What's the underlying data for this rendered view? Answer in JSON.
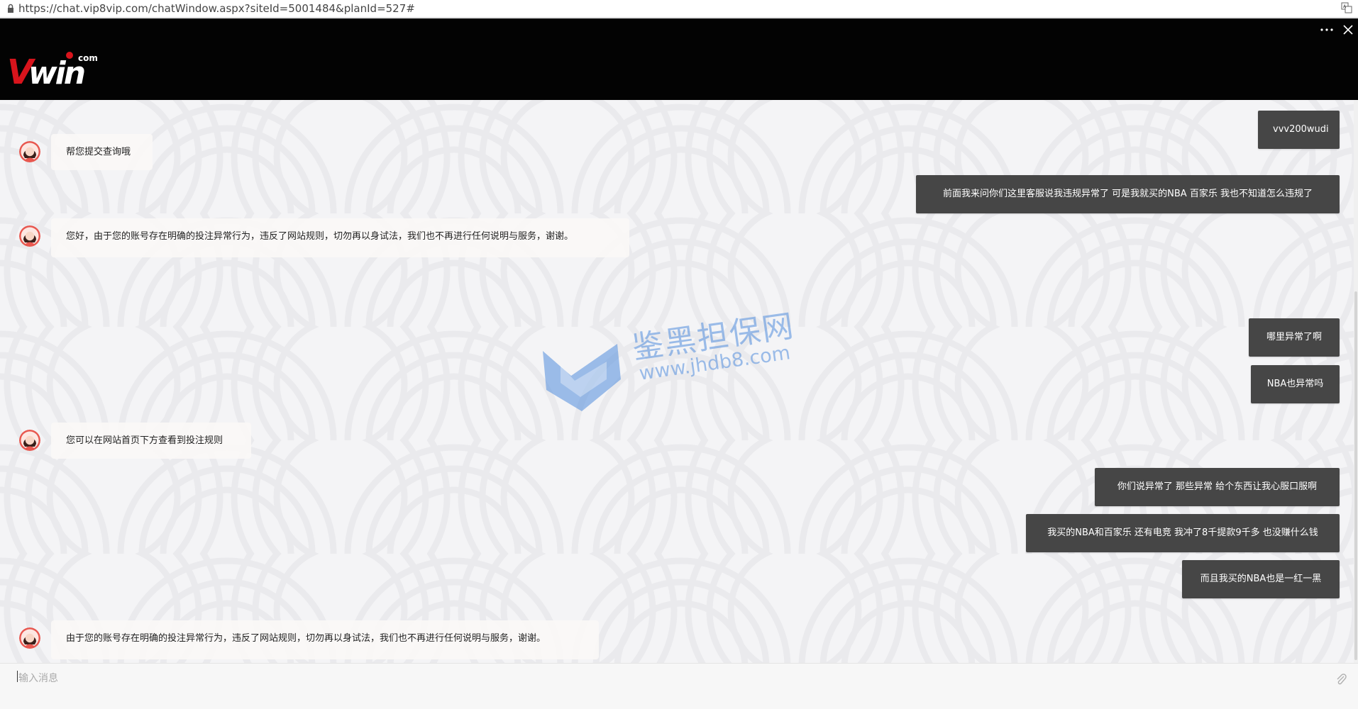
{
  "browser": {
    "url": "https://chat.vip8vip.com/chatWindow.aspx?siteId=5001484&planId=527#"
  },
  "brand": {
    "logo_text": "Vwin",
    "logo_suffix": ".com",
    "colors": {
      "header_bg": "#030303",
      "logo_red": "#d8141c",
      "outgoing_bubble": "#464646",
      "incoming_bubble": "#faf7f6"
    }
  },
  "header": {
    "icons": [
      "more-icon",
      "close-icon"
    ]
  },
  "messages": [
    {
      "side": "out",
      "text": "vvv200wudi"
    },
    {
      "side": "in",
      "text": "帮您提交查询哦"
    },
    {
      "side": "out",
      "text": "前面我来问你们这里客服说我违规异常了 可是我就买的NBA 百家乐 我也不知道怎么违规了"
    },
    {
      "side": "in",
      "text": "您好，由于您的账号存在明确的投注异常行为，违反了网站规则，切勿再以身试法，我们也不再进行任何说明与服务，谢谢。"
    },
    {
      "side": "out",
      "text": "哪里异常了啊"
    },
    {
      "side": "out",
      "text": "NBA也异常吗"
    },
    {
      "side": "in",
      "text": "您可以在网站首页下方查看到投注规则"
    },
    {
      "side": "out",
      "text": "你们说异常了 那些异常 给个东西让我心服口服啊"
    },
    {
      "side": "out",
      "text": "我买的NBA和百家乐 还有电竞 我冲了8千提款9千多 也没赚什么钱"
    },
    {
      "side": "out",
      "text": "而且我买的NBA也是一红一黑"
    },
    {
      "side": "in",
      "text": "由于您的账号存在明确的投注异常行为，违反了网站规则，切勿再以身试法，我们也不再进行任何说明与服务，谢谢。"
    }
  ],
  "watermark": {
    "cn": "鉴黑担保网",
    "url": "www.jhdb8.com"
  },
  "input": {
    "placeholder": "输入消息",
    "value": ""
  }
}
